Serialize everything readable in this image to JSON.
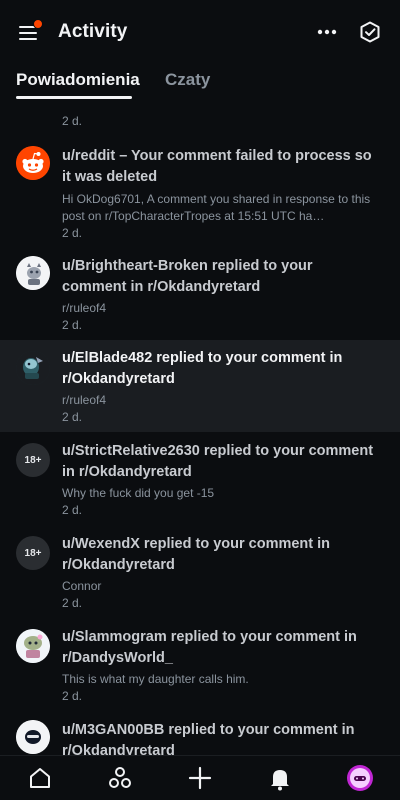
{
  "header": {
    "title": "Activity",
    "menu_icon": "hamburger-menu-icon",
    "notification_dot_color": "#ff4500",
    "more_icon": "more-dots-icon",
    "mark_read_icon": "mark-all-read-icon"
  },
  "tabs": [
    {
      "label": "Powiadomienia",
      "active": true
    },
    {
      "label": "Czaty",
      "active": false
    }
  ],
  "notifications": [
    {
      "avatar": "none",
      "title": "",
      "subtitle": "",
      "time": "2 d."
    },
    {
      "avatar": "reddit-logo",
      "title": "u/reddit – Your comment failed to process so it was deleted",
      "subtitle": "Hi OkDog6701, A comment you shared in response to this post on r/TopCharacterTropes at 15:51 UTC ha…",
      "time": "2 d."
    },
    {
      "avatar": "user-avatar",
      "title": "u/Brightheart-Broken replied to your comment in r/Okdandyretard",
      "subtitle": "r/ruleof4",
      "time": "2 d."
    },
    {
      "avatar": "user-avatar",
      "title": "u/ElBlade482 replied to your comment in r/Okdandyretard",
      "subtitle": "r/ruleof4",
      "time": "2 d.",
      "unread": true
    },
    {
      "avatar": "nsfw",
      "nsfw_label": "18+",
      "title": "u/StrictRelative2630 replied to your comment in r/Okdandyretard",
      "subtitle": "Why the fuck did you get -15",
      "time": "2 d."
    },
    {
      "avatar": "nsfw",
      "nsfw_label": "18+",
      "title": "u/WexendX replied to your comment in r/Okdandyretard",
      "subtitle": "Connor",
      "time": "2 d."
    },
    {
      "avatar": "user-avatar",
      "title": "u/Slammogram replied to your comment in r/DandysWorld_",
      "subtitle": "This is what my daughter calls him.",
      "time": "2 d."
    },
    {
      "avatar": "user-avatar",
      "title": "u/M3GAN00BB replied to your comment in r/Okdandyretard",
      "subtitle": "",
      "time": ""
    }
  ],
  "bottom_nav": [
    {
      "icon": "home-icon"
    },
    {
      "icon": "communities-icon"
    },
    {
      "icon": "create-plus-icon"
    },
    {
      "icon": "notifications-bell-icon",
      "active": true
    },
    {
      "icon": "profile-avatar-icon"
    }
  ],
  "colors": {
    "background": "#0b0d10",
    "highlight_row": "#1a1d21",
    "muted_text": "#8b949e",
    "accent": "#ff4500"
  }
}
